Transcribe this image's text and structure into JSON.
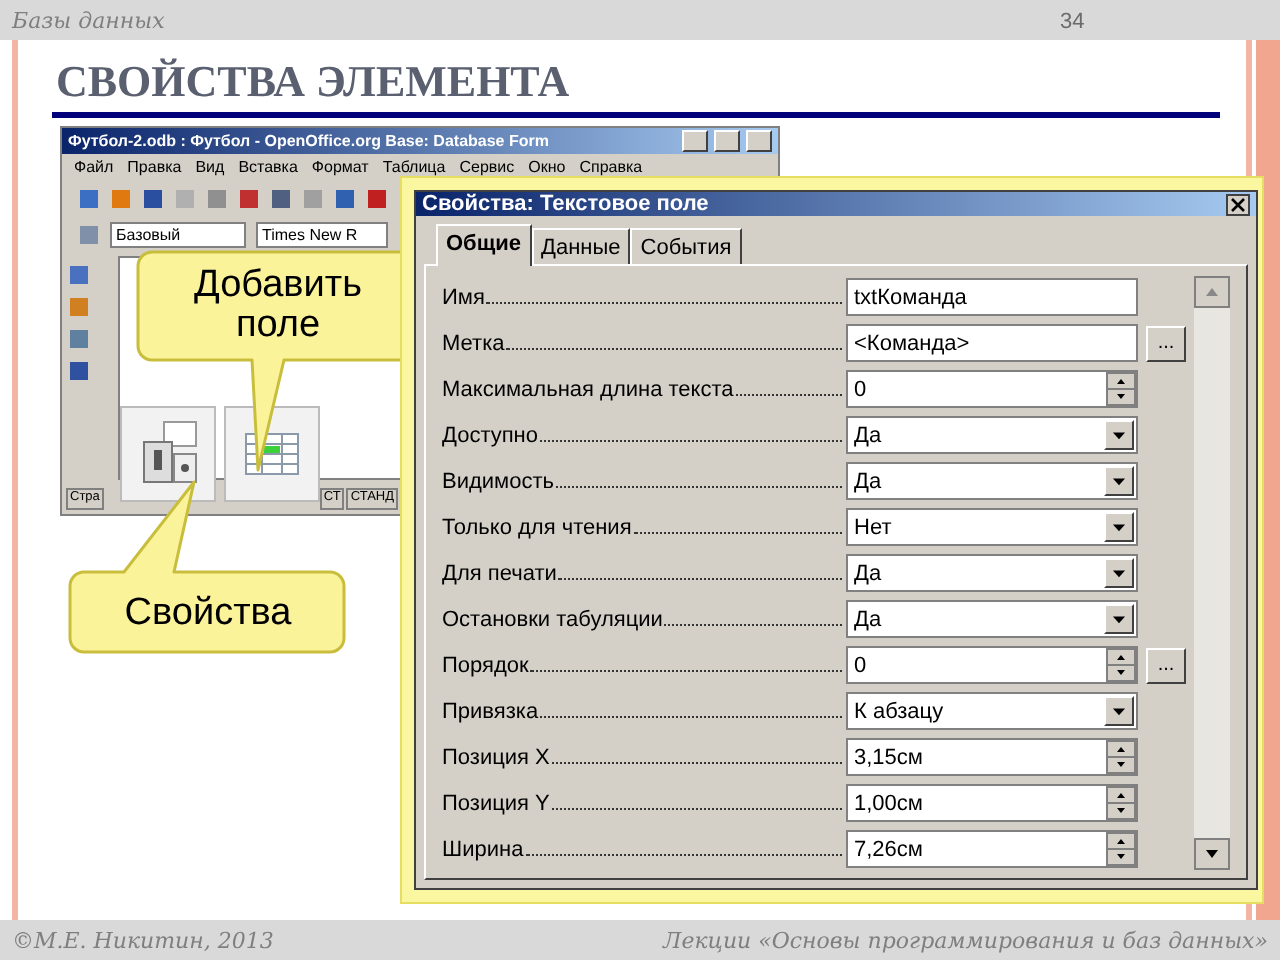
{
  "slide": {
    "header": "Базы данных",
    "page_number": "34",
    "title": "СВОЙСТВА ЭЛЕМЕНТА",
    "footer_left": "©М.Е. Никитин, 2013",
    "footer_right": "Лекции «Основы программирования и баз данных»"
  },
  "app_window": {
    "title": "Футбол-2.odb : Футбол - OpenOffice.org Base: Database Form",
    "menu": [
      "Файл",
      "Правка",
      "Вид",
      "Вставка",
      "Формат",
      "Таблица",
      "Сервис",
      "Окно",
      "Справка"
    ],
    "style_combo": "Базовый",
    "font_combo": "Times New R",
    "status": [
      "Стра",
      "СТ",
      "СТАНД"
    ]
  },
  "dialog": {
    "title": "Свойства: Текстовое поле",
    "tabs": [
      {
        "label": "Общие",
        "selected": true
      },
      {
        "label": "Данные",
        "selected": false
      },
      {
        "label": "События",
        "selected": false
      }
    ],
    "properties": [
      {
        "label": "Имя",
        "kind": "text",
        "value": "txtКоманда"
      },
      {
        "label": "Метка",
        "kind": "text",
        "value": "<Команда>",
        "button": "..."
      },
      {
        "label": "Максимальная длина текста",
        "kind": "spin",
        "value": "0"
      },
      {
        "label": "Доступно",
        "kind": "dropdown",
        "value": "Да"
      },
      {
        "label": "Видимость",
        "kind": "dropdown",
        "value": "Да"
      },
      {
        "label": "Только для чтения",
        "kind": "dropdown",
        "value": "Нет"
      },
      {
        "label": "Для печати",
        "kind": "dropdown",
        "value": "Да"
      },
      {
        "label": "Остановки табуляции",
        "kind": "dropdown",
        "value": "Да"
      },
      {
        "label": "Порядок",
        "kind": "spin",
        "value": "0",
        "button": "..."
      },
      {
        "label": "Привязка",
        "kind": "dropdown",
        "value": "К абзацу"
      },
      {
        "label": "Позиция X",
        "kind": "spin",
        "value": "3,15см"
      },
      {
        "label": "Позиция Y",
        "kind": "spin",
        "value": "1,00см"
      },
      {
        "label": "Ширина",
        "kind": "spin",
        "value": "7,26см"
      }
    ]
  },
  "callouts": [
    {
      "text": "Добавить поле"
    },
    {
      "text": "Свойства"
    }
  ]
}
